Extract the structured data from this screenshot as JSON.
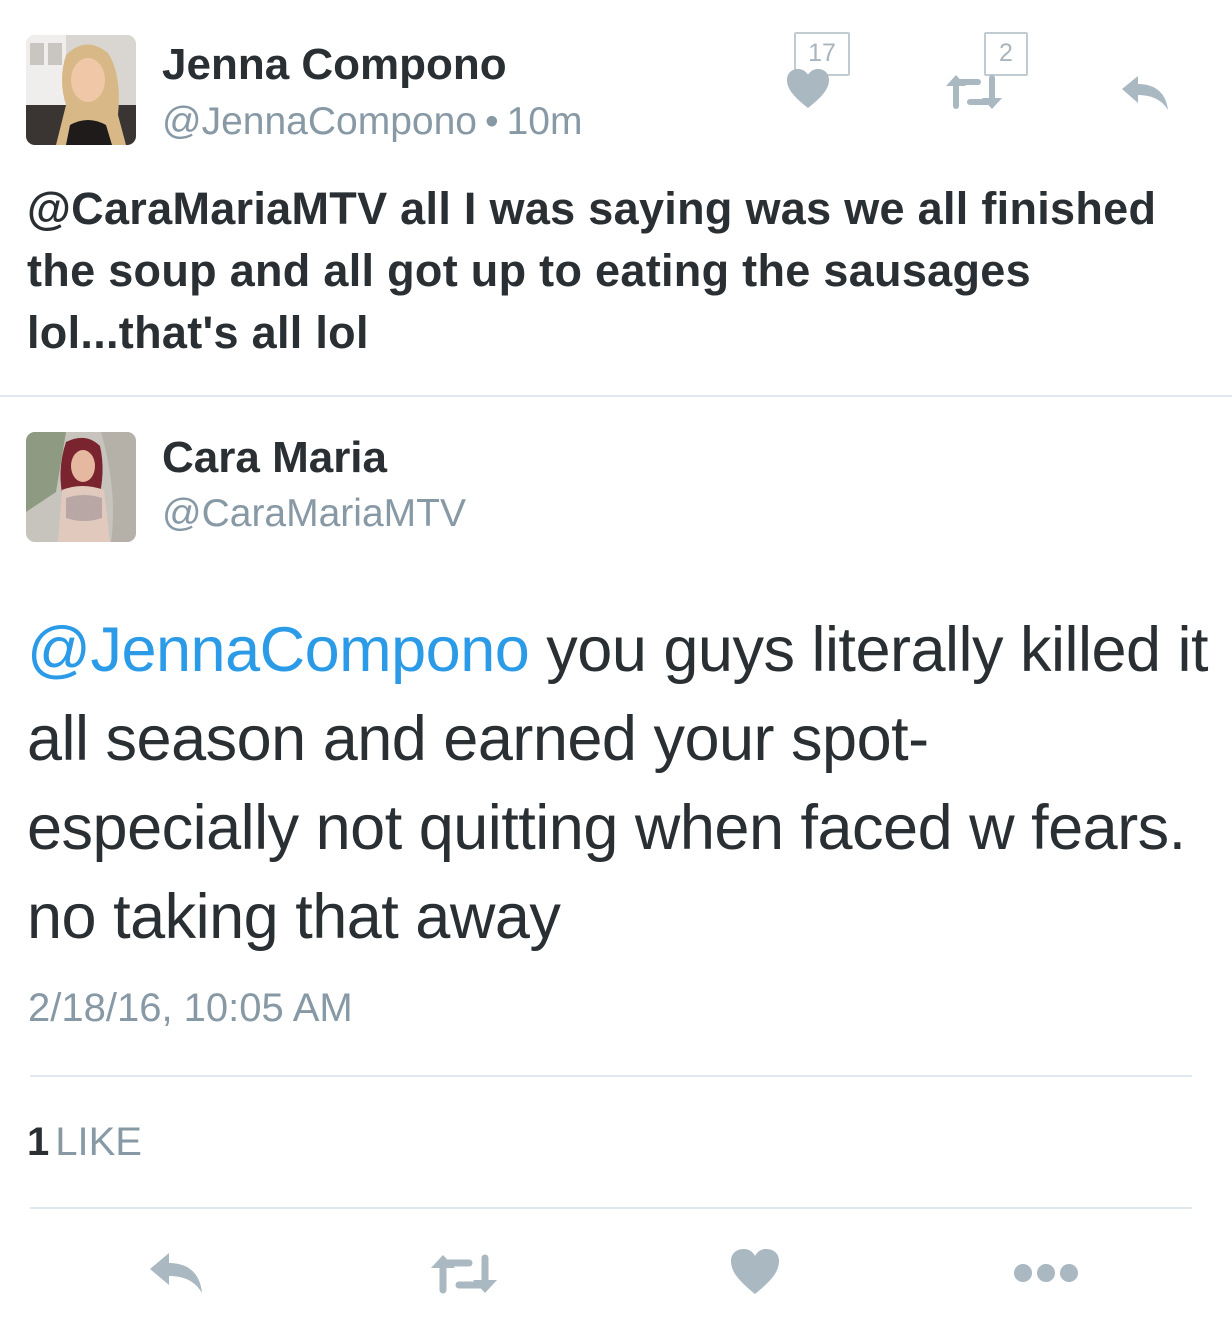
{
  "colors": {
    "text": "#292f33",
    "secondary": "#8899a6",
    "link": "#2b9be8",
    "icon": "#aab8c2",
    "divider": "#e1e8ed"
  },
  "tweet1": {
    "avatar_icon": "jenna-avatar",
    "name": "Jenna Compono",
    "handle": "@JennaCompono",
    "separator": "•",
    "time": "10m",
    "text": "@CaraMariaMTV all I was saying was we all finished the soup and all got up to eating the sausages lol...that's all lol",
    "like_count": "17",
    "retweet_count": "2",
    "icons": {
      "like": "heart-icon",
      "retweet": "retweet-icon",
      "reply": "reply-icon"
    }
  },
  "tweet2": {
    "avatar_icon": "cara-avatar",
    "name": "Cara Maria",
    "handle": "@CaraMariaMTV",
    "mention": "@JennaCompono",
    "text": " you guys literally killed it all season and earned your spot- especially not quitting when faced w fears. no taking that away",
    "timestamp": "2/18/16, 10:05 AM",
    "likes_count": "1",
    "likes_label": "LIKE"
  },
  "action_bar": {
    "icons": [
      "reply-icon",
      "retweet-icon",
      "heart-icon",
      "more-icon"
    ]
  }
}
